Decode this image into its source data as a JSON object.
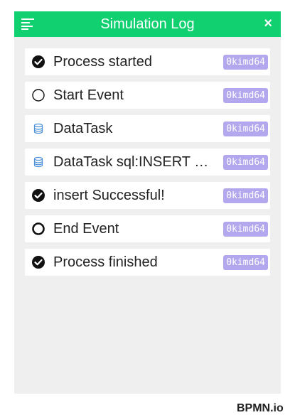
{
  "panel": {
    "title": "Simulation Log",
    "close_symbol": "×",
    "accent_color": "#10d070",
    "badge_color": "#b3a8ee",
    "menu_icon": "menu-align-left-icon",
    "close_icon": "close-icon"
  },
  "entries": [
    {
      "icon": "check-circle-icon",
      "text": "Process started",
      "badge": "0kimd64"
    },
    {
      "icon": "circle-outline-icon",
      "text": "Start Event",
      "badge": "0kimd64"
    },
    {
      "icon": "database-icon",
      "text": "DataTask",
      "badge": "0kimd64"
    },
    {
      "icon": "database-icon",
      "text": "DataTask sql:INSERT INTO",
      "badge": "0kimd64"
    },
    {
      "icon": "check-circle-icon",
      "text": "insert Successful!",
      "badge": "0kimd64"
    },
    {
      "icon": "bold-circle-outline-icon",
      "text": "End Event",
      "badge": "0kimd64"
    },
    {
      "icon": "check-circle-icon",
      "text": "Process finished",
      "badge": "0kimd64"
    }
  ],
  "footer": {
    "watermark": "BPMN.io"
  }
}
